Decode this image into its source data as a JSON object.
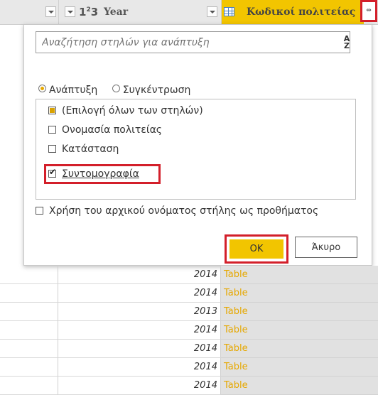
{
  "header": {
    "year_type": "1²3",
    "year_label": "Year",
    "codes_label": "Κωδικοί πολιτείας",
    "expand_icon_text": "⇹"
  },
  "dialog": {
    "search_placeholder": "Αναζήτηση στηλών για ανάπτυξη",
    "sort_label": "A Z",
    "radio_expand": "Ανάπτυξη",
    "radio_aggregate": "Συγκέντρωση",
    "selected_mode": "Ανάπτυξη",
    "items": [
      {
        "label": "(Επιλογή όλων των στηλών)",
        "state": "partial"
      },
      {
        "label": "Ονομασία πολιτείας",
        "state": "unchecked"
      },
      {
        "label": "Κατάσταση",
        "state": "unchecked"
      },
      {
        "label": "Συντομογραφία",
        "state": "checked"
      }
    ],
    "prefix_label": "Χρήση του αρχικού ονόματος στήλης ως προθήματος",
    "prefix_checked": false,
    "ok_label": "OK",
    "cancel_label": "Άκυρο"
  },
  "rows": [
    {
      "year": "2014",
      "value": "Table"
    },
    {
      "year": "2014",
      "value": "Table"
    },
    {
      "year": "2013",
      "value": "Table"
    },
    {
      "year": "2014",
      "value": "Table"
    },
    {
      "year": "2014",
      "value": "Table"
    },
    {
      "year": "2014",
      "value": "Table"
    },
    {
      "year": "2014",
      "value": "Table"
    }
  ],
  "colors": {
    "accent": "#f2c500",
    "highlight_box": "#d31f2a",
    "table_text": "#e6a800"
  }
}
